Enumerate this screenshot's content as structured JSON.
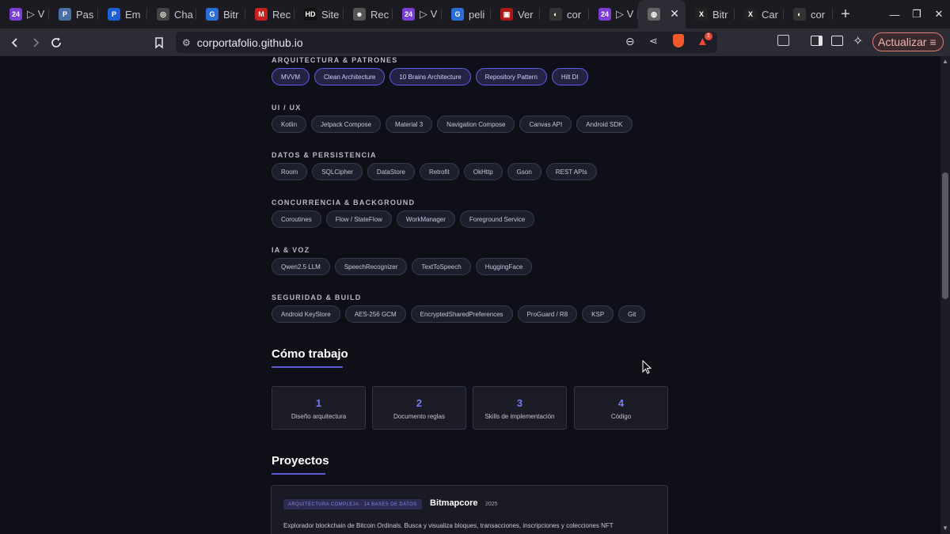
{
  "browser": {
    "tabs": [
      {
        "label": "▷ V",
        "icon": "24",
        "color": "#7b3fd6"
      },
      {
        "label": "Pas",
        "icon": "P",
        "color": "#4a6fa5"
      },
      {
        "label": "Em",
        "icon": "P",
        "color": "#1f5fd6"
      },
      {
        "label": "Cha",
        "icon": "◎",
        "color": "#444"
      },
      {
        "label": "Bitr",
        "icon": "G",
        "color": "#2b6fd6"
      },
      {
        "label": "Rec",
        "icon": "M",
        "color": "#c5221f"
      },
      {
        "label": "Site",
        "icon": "HD",
        "color": "#111"
      },
      {
        "label": "Rec",
        "icon": "☻",
        "color": "#555"
      },
      {
        "label": "▷ V",
        "icon": "24",
        "color": "#7b3fd6"
      },
      {
        "label": "peli",
        "icon": "G",
        "color": "#2b6fd6"
      },
      {
        "label": "Ver",
        "icon": "▣",
        "color": "#b01818"
      },
      {
        "label": "cor",
        "icon": "◐",
        "color": "#333"
      },
      {
        "label": "▷ V",
        "icon": "24",
        "color": "#7b3fd6"
      },
      {
        "label": "",
        "icon": "◍",
        "color": "#666"
      },
      {
        "label": "Bitr",
        "icon": "X",
        "color": "#222"
      },
      {
        "label": "Car",
        "icon": "X",
        "color": "#222"
      },
      {
        "label": "cor",
        "icon": "◐",
        "color": "#333"
      }
    ],
    "active_tab_close": "✕",
    "new_tab": "+",
    "url": "corportafolio.github.io",
    "update_label": "Actualizar",
    "shield_badge": "1"
  },
  "skills": {
    "categories": [
      {
        "title": "ARQUITECTURA & PATRONES",
        "chips": [
          "MVVM",
          "Clean Architecture",
          "10 Brains Architecture",
          "Repository Pattern",
          "Hilt DI"
        ]
      },
      {
        "title": "UI / UX",
        "chips": [
          "Kotlin",
          "Jetpack Compose",
          "Material 3",
          "Navigation Compose",
          "Canvas API",
          "Android SDK"
        ]
      },
      {
        "title": "DATOS & PERSISTENCIA",
        "chips": [
          "Room",
          "SQLCipher",
          "DataStore",
          "Retrofit",
          "OkHttp",
          "Gson",
          "REST APIs"
        ]
      },
      {
        "title": "CONCURRENCIA & BACKGROUND",
        "chips": [
          "Coroutines",
          "Flow / StateFlow",
          "WorkManager",
          "Foreground Service"
        ]
      },
      {
        "title": "IA & VOZ",
        "chips": [
          "Qwen2.5 LLM",
          "SpeechRecognizer",
          "TextToSpeech",
          "HuggingFace"
        ]
      },
      {
        "title": "SEGURIDAD & BUILD",
        "chips": [
          "Android KeyStore",
          "AES-256 GCM",
          "EncryptedSharedPreferences",
          "ProGuard / R8",
          "KSP",
          "Git"
        ]
      }
    ]
  },
  "como_trabajo": {
    "title": "Cómo trabajo",
    "steps": [
      {
        "number": "1",
        "label": "Diseño arquitectura"
      },
      {
        "number": "2",
        "label": "Documento reglas"
      },
      {
        "number": "3",
        "label": "Skills de implementación"
      },
      {
        "number": "4",
        "label": "Código"
      }
    ]
  },
  "proyectos": {
    "title": "Proyectos",
    "card": {
      "badge": "ARQUITECTURA COMPLEJA · 14 BASES DE DATOS",
      "name": "Bitmapcore",
      "year": "2025",
      "description": "Explorador blockchain de Bitcoin Ordinals. Busca y visualiza bloques, transacciones, inscripciones y colecciones NFT"
    }
  }
}
